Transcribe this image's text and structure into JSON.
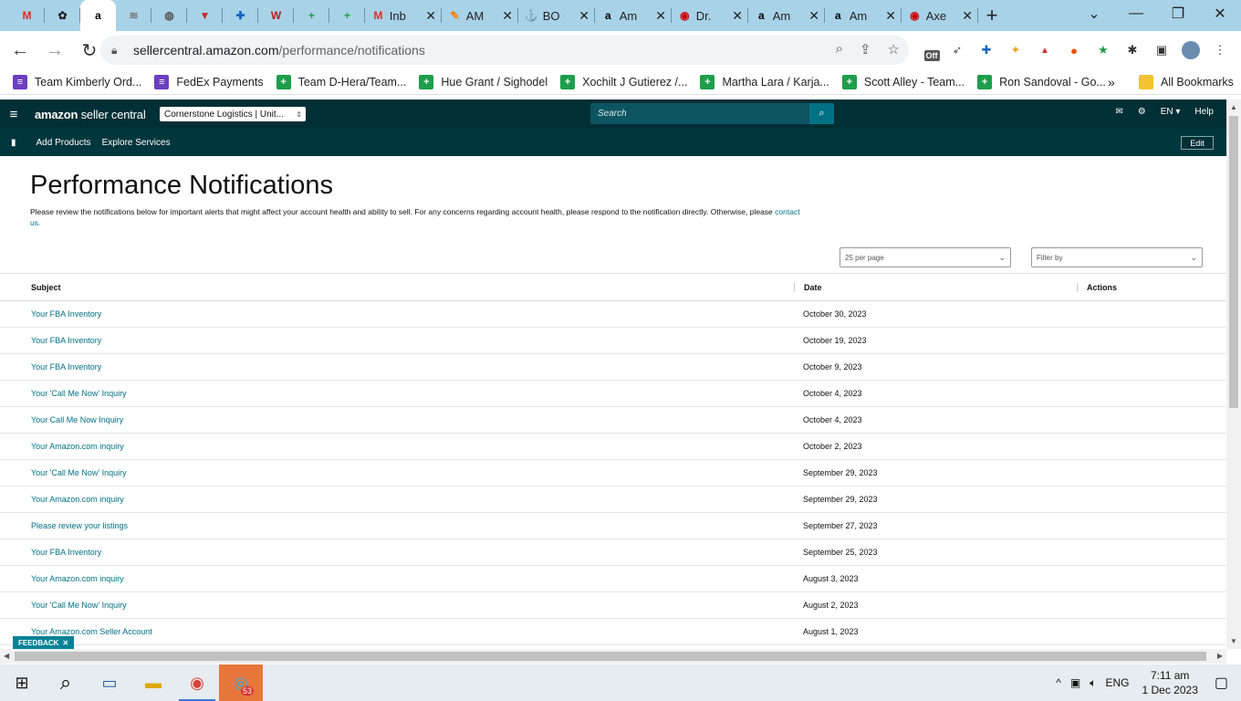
{
  "browser": {
    "tabs": [
      {
        "title": "",
        "icon": "gmail-icon",
        "glyph": "M",
        "color": "#d93025",
        "close": false
      },
      {
        "title": "",
        "icon": "openai-icon",
        "glyph": "✿",
        "color": "#222",
        "close": false
      },
      {
        "title": "",
        "icon": "amazon-icon",
        "glyph": "a",
        "color": "#000",
        "close": false,
        "active": true
      },
      {
        "title": "",
        "icon": "mailchimp-icon",
        "glyph": "≋",
        "color": "#777",
        "close": false
      },
      {
        "title": "",
        "icon": "globe-icon",
        "glyph": "◍",
        "color": "#555",
        "close": false
      },
      {
        "title": "",
        "icon": "flag-icon",
        "glyph": "▼",
        "color": "#c62828",
        "close": false
      },
      {
        "title": "",
        "icon": "lifebuoy-icon",
        "glyph": "✚",
        "color": "#1565c0",
        "close": false
      },
      {
        "title": "",
        "icon": "w-icon",
        "glyph": "W",
        "color": "#b71c1c",
        "close": false
      },
      {
        "title": "",
        "icon": "sheets-icon",
        "glyph": "+",
        "color": "#1e9e4a",
        "close": false
      },
      {
        "title": "",
        "icon": "sheets-icon",
        "glyph": "+",
        "color": "#1e9e4a",
        "close": false
      },
      {
        "title": "Inb",
        "icon": "gmail-icon",
        "glyph": "M",
        "color": "#d93025",
        "close": true
      },
      {
        "title": "AM",
        "icon": "pen-icon",
        "glyph": "✎",
        "color": "#f57c00",
        "close": true
      },
      {
        "title": "BO",
        "icon": "anchor-icon",
        "glyph": "⚓",
        "color": "#333",
        "close": true
      },
      {
        "title": "Am",
        "icon": "amazon-icon",
        "glyph": "a",
        "color": "#000",
        "close": true
      },
      {
        "title": "Dr.",
        "icon": "target-icon",
        "glyph": "◉",
        "color": "#cc0000",
        "close": true
      },
      {
        "title": "Am",
        "icon": "amazon-icon",
        "glyph": "a",
        "color": "#000",
        "close": true
      },
      {
        "title": "Am",
        "icon": "amazon-icon",
        "glyph": "a",
        "color": "#000",
        "close": true
      },
      {
        "title": "Axe",
        "icon": "target-icon",
        "glyph": "◉",
        "color": "#cc0000",
        "close": true
      }
    ],
    "url_host": "sellercentral.amazon.com",
    "url_path": "/performance/notifications",
    "bookmarks": [
      {
        "label": "Team Kimberly Ord...",
        "icon": "list-icon",
        "kind": "purple"
      },
      {
        "label": "FedEx Payments",
        "icon": "list-icon",
        "kind": "purple"
      },
      {
        "label": "Team D-Hera/Team...",
        "icon": "sheets-icon",
        "kind": "green"
      },
      {
        "label": "Hue Grant / Sighodel",
        "icon": "sheets-icon",
        "kind": "green"
      },
      {
        "label": "Xochilt J Gutierez /...",
        "icon": "sheets-icon",
        "kind": "green"
      },
      {
        "label": "Martha Lara / Karja...",
        "icon": "sheets-icon",
        "kind": "green"
      },
      {
        "label": "Scott Alley - Team...",
        "icon": "sheets-icon",
        "kind": "green"
      },
      {
        "label": "Ron Sandoval - Go...",
        "icon": "sheets-icon",
        "kind": "green"
      }
    ],
    "all_bookmarks": "All Bookmarks",
    "extension_off_badge": "Off"
  },
  "seller_central": {
    "logo_brand": "amazon",
    "logo_suffix": "seller central",
    "account": "Cornerstone Logistics | Unit...",
    "search_placeholder": "Search",
    "lang": "EN",
    "help": "Help",
    "subnav": [
      "Add Products",
      "Explore Services"
    ],
    "edit": "Edit"
  },
  "page": {
    "title": "Performance Notifications",
    "description": "Please review the notifications below for important alerts that might affect your account health and ability to sell. For any concerns regarding account health, please respond to the notification directly. Otherwise, please",
    "contact_link": "contact us.",
    "per_page": "25 per page",
    "filter_placeholder": "Filter by",
    "columns": {
      "subject": "Subject",
      "date": "Date",
      "actions": "Actions"
    },
    "rows": [
      {
        "subject": "Your FBA Inventory",
        "date": "October 30, 2023"
      },
      {
        "subject": "Your FBA Inventory",
        "date": "October 19, 2023"
      },
      {
        "subject": "Your FBA Inventory",
        "date": "October 9, 2023"
      },
      {
        "subject": "Your 'Call Me Now' Inquiry",
        "date": "October 4, 2023"
      },
      {
        "subject": "Your Call Me Now Inquiry",
        "date": "October 4, 2023"
      },
      {
        "subject": "Your Amazon.com inquiry",
        "date": "October 2, 2023"
      },
      {
        "subject": "Your 'Call Me Now' Inquiry",
        "date": "September 29, 2023"
      },
      {
        "subject": "Your Amazon.com inquiry",
        "date": "September 29, 2023"
      },
      {
        "subject": "Please review your listings",
        "date": "September 27, 2023"
      },
      {
        "subject": "Your FBA Inventory",
        "date": "September 25, 2023"
      },
      {
        "subject": "Your Amazon.com inquiry",
        "date": "August 3, 2023"
      },
      {
        "subject": "Your 'Call Me Now' Inquiry",
        "date": "August 2, 2023"
      },
      {
        "subject": "Your Amazon.com Seller Account",
        "date": "August 1, 2023"
      }
    ],
    "feedback": "FEEDBACK"
  },
  "taskbar": {
    "chrome_badge": "53",
    "lang": "ENG",
    "time": "7:11 am",
    "date": "1 Dec 2023"
  },
  "colors": {
    "header_bg": "#002f36",
    "link": "#007185",
    "tabstrip": "#a8d2e8"
  }
}
